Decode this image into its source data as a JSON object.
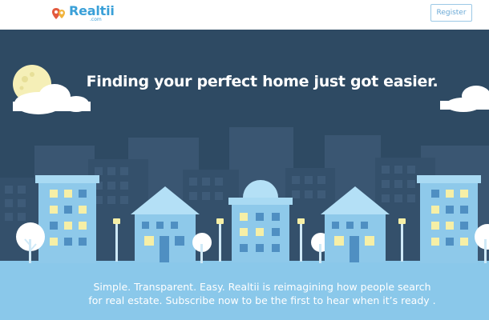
{
  "header": {
    "logo": {
      "name": "Realtii",
      "sub": ".com"
    },
    "register_label": "Register"
  },
  "hero": {
    "headline": "Finding your perfect home just got easier.",
    "tagline_line1": "Simple. Transparent. Easy. Realtii is reimagining how people search",
    "tagline_line2": "for real estate. Subscribe now to be the first to hear when it’s ready ."
  },
  "colors": {
    "sky": "#2e4a63",
    "brand_blue": "#3aa0d8",
    "building_light": "#8ec9ea",
    "window_yellow": "#f6efa6",
    "ground": "#8ac8ea"
  }
}
